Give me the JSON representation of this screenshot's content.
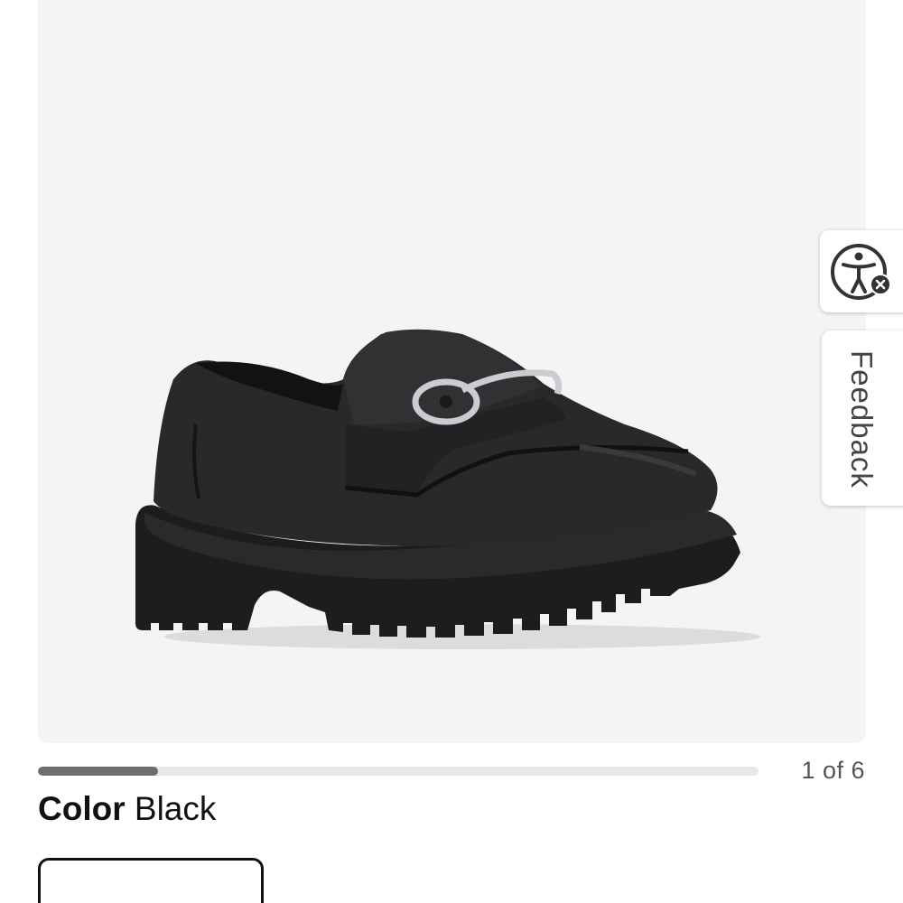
{
  "gallery": {
    "current": 1,
    "total": 6,
    "counter_text": "1 of 6",
    "progress_fraction": 0.1667,
    "progress_color": "#6e6e6e",
    "track_color": "#e7e7e7",
    "background": "#f4f4f5"
  },
  "product": {
    "image_icon": "product-photo-black-lug-sole-loafer"
  },
  "color": {
    "label": "Color",
    "value": "Black"
  },
  "widgets": {
    "accessibility_icon": "accessibility-icon",
    "feedback_label": "Feedback"
  }
}
